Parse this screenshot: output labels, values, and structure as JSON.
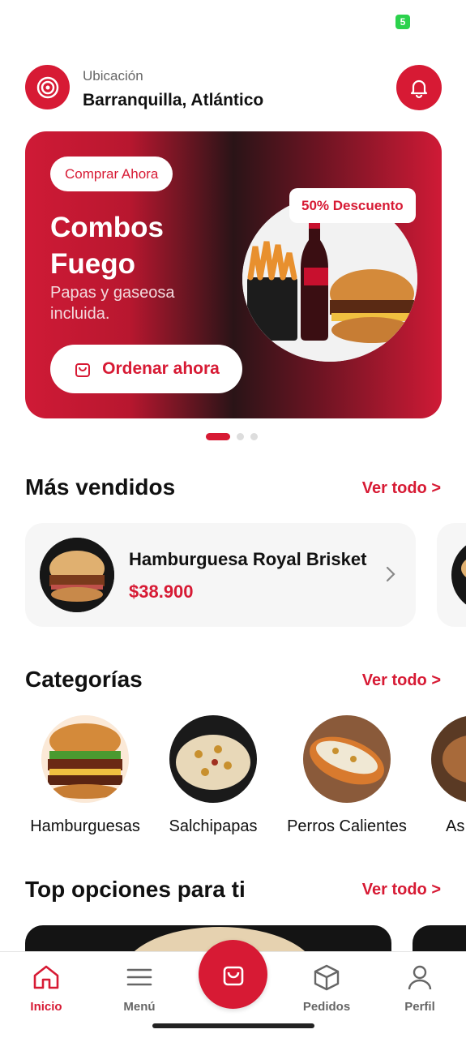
{
  "status_bar": {
    "battery": "5"
  },
  "header": {
    "location_label": "Ubicación",
    "location_value": "Barranquilla, Atlántico"
  },
  "banner": {
    "badge": "Comprar Ahora",
    "title": "Combos Fuego",
    "subtitle": "Papas y gaseosa incluida.",
    "discount": "50% Descuento",
    "cta": "Ordenar ahora",
    "pages": 3,
    "current_page": 1
  },
  "best_sellers": {
    "title": "Más vendidos",
    "see_all": "Ver todo >",
    "items": [
      {
        "name": "Hamburguesa Royal Brisket",
        "price": "$38.900"
      }
    ]
  },
  "categories": {
    "title": "Categorías",
    "see_all": "Ver todo >",
    "items": [
      {
        "label": "Hamburguesas"
      },
      {
        "label": "Salchipapas"
      },
      {
        "label": "Perros Calientes"
      },
      {
        "label": "As"
      }
    ]
  },
  "top_options": {
    "title": "Top opciones para ti",
    "see_all": "Ver todo >"
  },
  "tabbar": {
    "items": [
      {
        "label": "Inicio",
        "icon": "home-icon"
      },
      {
        "label": "Menú",
        "icon": "menu-icon"
      },
      {
        "label": "Pedidos",
        "icon": "box-icon"
      },
      {
        "label": "Perfil",
        "icon": "user-icon"
      }
    ],
    "cart_icon": "shopping-bag-icon"
  },
  "colors": {
    "accent": "#d71a34",
    "dark": "#141414",
    "card": "#f6f6f6"
  }
}
